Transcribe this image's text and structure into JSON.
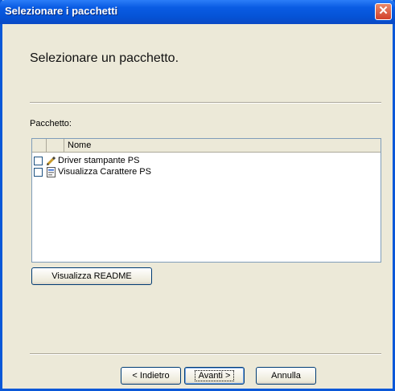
{
  "window": {
    "title": "Selezionare i pacchetti",
    "close_glyph": "✕"
  },
  "header": {
    "title": "Selezionare un pacchetto."
  },
  "package_section": {
    "label": "Pacchetto:",
    "columns": [
      "",
      "Nome"
    ],
    "items": [
      {
        "name": "Driver stampante PS",
        "checked": false,
        "icon": "pencil-icon"
      },
      {
        "name": "Visualizza Carattere PS",
        "checked": false,
        "icon": "document-icon"
      }
    ]
  },
  "readme_button": {
    "label": "Visualizza README"
  },
  "footer": {
    "back_label": "< Indietro",
    "next_label": "Avanti >",
    "cancel_label": "Annulla"
  },
  "colors": {
    "titlebar": "#0553d6",
    "background": "#ece9d8",
    "close": "#d2402a"
  }
}
